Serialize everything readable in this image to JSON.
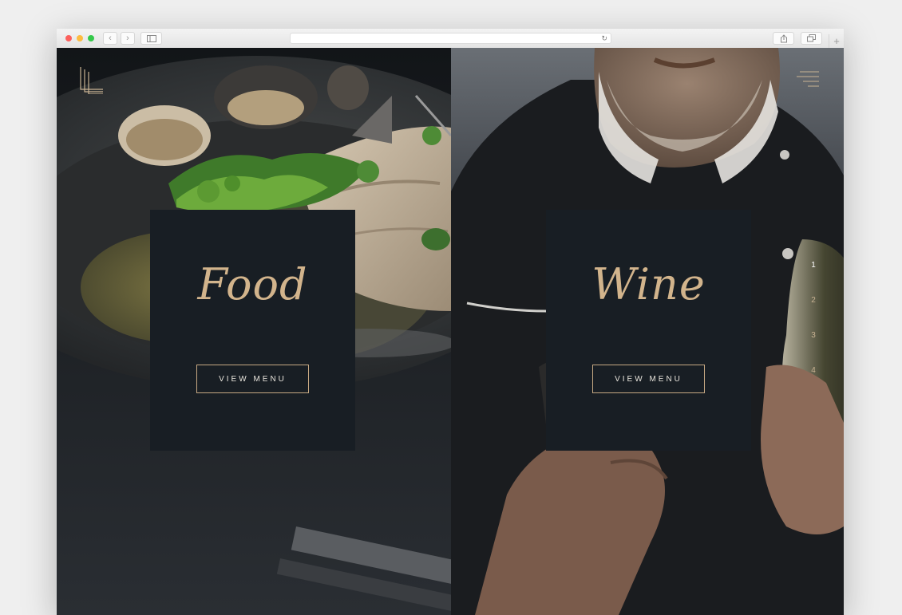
{
  "browser": {
    "address_url": "",
    "new_tab_label": "+"
  },
  "panels": [
    {
      "title": "Food",
      "button_label": "VIEW MENU"
    },
    {
      "title": "Wine",
      "button_label": "VIEW MENU"
    }
  ],
  "slide_nav": [
    "1",
    "2",
    "3",
    "4"
  ],
  "colors": {
    "accent_gold": "#d2b48c",
    "card_background": "#181e24",
    "page_background": "#1a1f25"
  },
  "icons": {
    "logo": "lines-logo-icon",
    "menu": "hamburger-menu-icon"
  }
}
